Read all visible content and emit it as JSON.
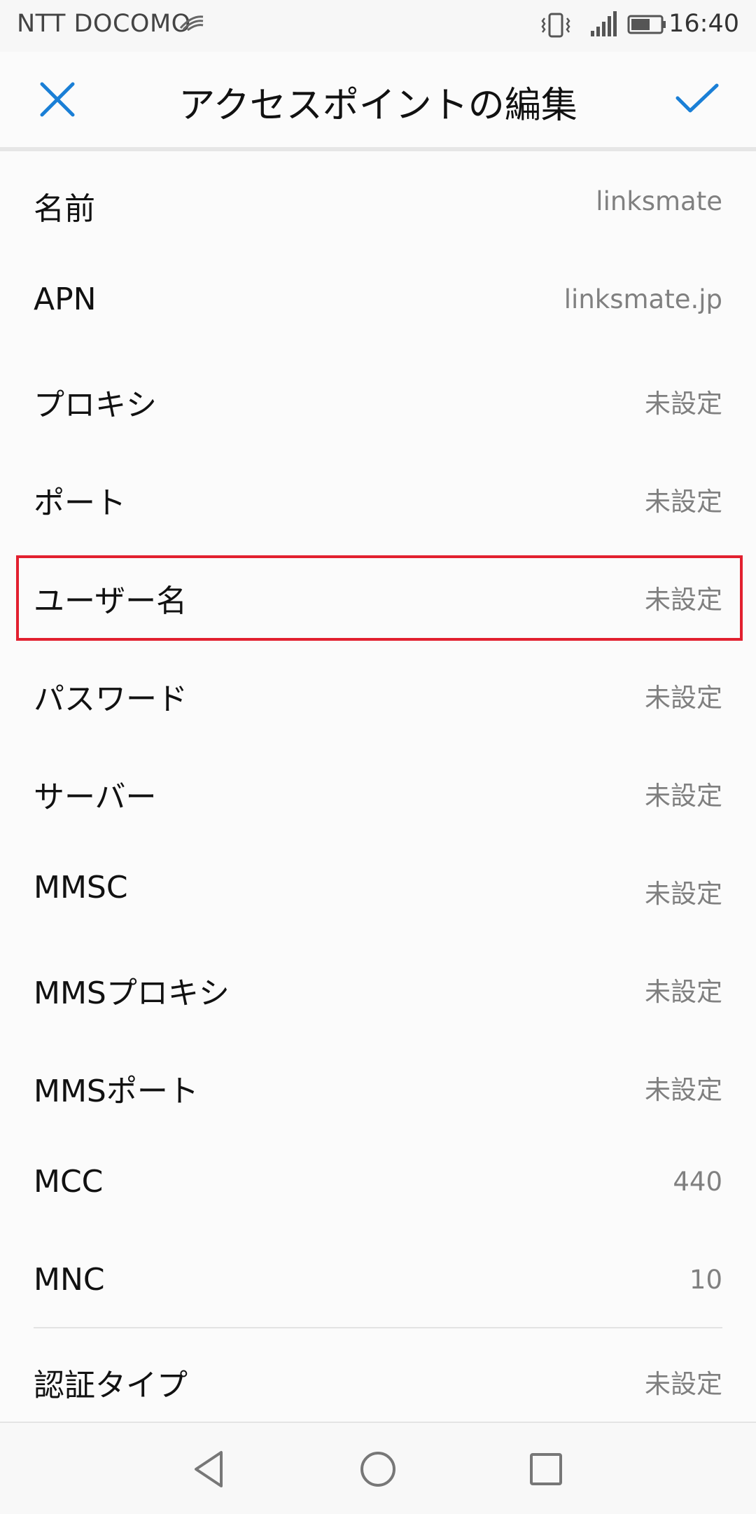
{
  "status_bar": {
    "carrier": "NTT DOCOMO",
    "time": "16:40",
    "icons": [
      "vibrate-icon",
      "signal-icon",
      "battery-icon"
    ]
  },
  "app_bar": {
    "title": "アクセスポイントの編集",
    "close_icon": "close-icon",
    "confirm_icon": "check-icon",
    "accent_color": "#1a7fd6"
  },
  "fields": [
    {
      "label": "名前",
      "value": "linksmate"
    },
    {
      "label": "APN",
      "value": "linksmate.jp"
    },
    {
      "label": "プロキシ",
      "value": "未設定"
    },
    {
      "label": "ポート",
      "value": "未設定"
    },
    {
      "label": "ユーザー名",
      "value": "未設定"
    },
    {
      "label": "パスワード",
      "value": "未設定"
    },
    {
      "label": "サーバー",
      "value": "未設定"
    },
    {
      "label": "MMSC",
      "value": "未設定"
    },
    {
      "label": "MMSプロキシ",
      "value": "未設定"
    },
    {
      "label": "MMSポート",
      "value": "未設定"
    },
    {
      "label": "MCC",
      "value": "440"
    },
    {
      "label": "MNC",
      "value": "10"
    },
    {
      "label": "認証タイプ",
      "value": "未設定"
    }
  ],
  "highlight": {
    "field_label": "ユーザー名",
    "color": "#e2202f"
  },
  "nav_bar": {
    "icons": [
      "back-icon",
      "home-icon",
      "recents-icon"
    ]
  }
}
